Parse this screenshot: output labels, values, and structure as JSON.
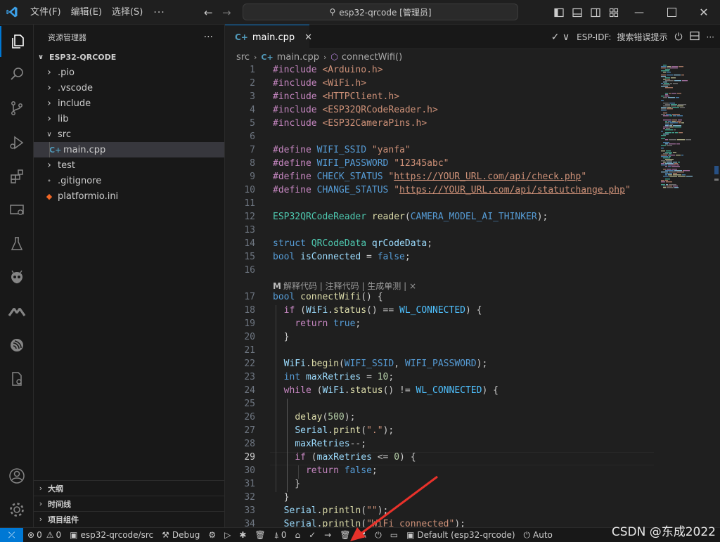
{
  "titlebar": {
    "menus": [
      "文件(F)",
      "编辑(E)",
      "选择(S)"
    ],
    "more": "···",
    "command_center": "esp32-qrcode [管理员]"
  },
  "sidebar": {
    "title": "资源管理器",
    "more": "···",
    "root": "ESP32-QRCODE",
    "items": [
      {
        "label": ".pio",
        "kind": "folder",
        "expanded": false
      },
      {
        "label": ".vscode",
        "kind": "folder",
        "expanded": false
      },
      {
        "label": "include",
        "kind": "folder",
        "expanded": false
      },
      {
        "label": "lib",
        "kind": "folder",
        "expanded": false
      },
      {
        "label": "src",
        "kind": "folder",
        "expanded": true
      },
      {
        "label": "main.cpp",
        "kind": "cpp",
        "selected": true
      },
      {
        "label": "test",
        "kind": "folder",
        "expanded": false
      },
      {
        "label": ".gitignore",
        "kind": "git"
      },
      {
        "label": "platformio.ini",
        "kind": "pio"
      }
    ],
    "sections": [
      "大纲",
      "时间线",
      "项目组件"
    ]
  },
  "editor": {
    "tab": "main.cpp",
    "tab_actions": {
      "idf": "ESP-IDF:",
      "search": "搜索错误提示"
    },
    "breadcrumb": [
      "src",
      "main.cpp",
      "connectWifi()"
    ],
    "codelens": "解释代码 | 注释代码 | 生成单测 | ×",
    "current_line": 29,
    "lines": [
      {
        "n": 1,
        "t": [
          [
            "pp",
            "#include"
          ],
          [
            "pn",
            " "
          ],
          [
            "st",
            "<Arduino.h>"
          ]
        ]
      },
      {
        "n": 2,
        "t": [
          [
            "pp",
            "#include"
          ],
          [
            "pn",
            " "
          ],
          [
            "st",
            "<WiFi.h>"
          ]
        ]
      },
      {
        "n": 3,
        "t": [
          [
            "pp",
            "#include"
          ],
          [
            "pn",
            " "
          ],
          [
            "st",
            "<HTTPClient.h>"
          ]
        ]
      },
      {
        "n": 4,
        "t": [
          [
            "pp",
            "#include"
          ],
          [
            "pn",
            " "
          ],
          [
            "st",
            "<ESP32QRCodeReader.h>"
          ]
        ]
      },
      {
        "n": 5,
        "t": [
          [
            "pp",
            "#include"
          ],
          [
            "pn",
            " "
          ],
          [
            "st",
            "<ESP32CameraPins.h>"
          ]
        ]
      },
      {
        "n": 6,
        "t": []
      },
      {
        "n": 7,
        "t": [
          [
            "pp",
            "#define"
          ],
          [
            "pn",
            " "
          ],
          [
            "ty",
            "WIFI_SSID"
          ],
          [
            "pn",
            " "
          ],
          [
            "st",
            "\"yanfa\""
          ]
        ]
      },
      {
        "n": 8,
        "t": [
          [
            "pp",
            "#define"
          ],
          [
            "pn",
            " "
          ],
          [
            "ty",
            "WIFI_PASSWORD"
          ],
          [
            "pn",
            " "
          ],
          [
            "st",
            "\"12345abc\""
          ]
        ]
      },
      {
        "n": 9,
        "t": [
          [
            "pp",
            "#define"
          ],
          [
            "pn",
            " "
          ],
          [
            "ty",
            "CHECK_STATUS"
          ],
          [
            "pn",
            " "
          ],
          [
            "st",
            "\""
          ],
          [
            "stu",
            "https://YOUR_URL.com/api/check.php"
          ],
          [
            "st",
            "\""
          ]
        ]
      },
      {
        "n": 10,
        "t": [
          [
            "pp",
            "#define"
          ],
          [
            "pn",
            " "
          ],
          [
            "ty",
            "CHANGE_STATUS"
          ],
          [
            "pn",
            " "
          ],
          [
            "st",
            "\""
          ],
          [
            "stu",
            "https://YOUR_URL.com/api/statutchange.php"
          ],
          [
            "st",
            "\""
          ]
        ]
      },
      {
        "n": 11,
        "t": []
      },
      {
        "n": 12,
        "t": [
          [
            "cl",
            "ESP32QRCodeReader"
          ],
          [
            "pn",
            " "
          ],
          [
            "fn",
            "reader"
          ],
          [
            "pn",
            "("
          ],
          [
            "ty",
            "CAMERA_MODEL_AI_THINKER"
          ],
          [
            "pn",
            ");"
          ]
        ]
      },
      {
        "n": 13,
        "t": []
      },
      {
        "n": 14,
        "t": [
          [
            "ty",
            "struct"
          ],
          [
            "pn",
            " "
          ],
          [
            "cl",
            "QRCodeData"
          ],
          [
            "pn",
            " "
          ],
          [
            "va",
            "qrCodeData"
          ],
          [
            "pn",
            ";"
          ]
        ]
      },
      {
        "n": 15,
        "t": [
          [
            "ty",
            "bool"
          ],
          [
            "pn",
            " "
          ],
          [
            "va",
            "isConnected"
          ],
          [
            "pn",
            " = "
          ],
          [
            "ty",
            "false"
          ],
          [
            "pn",
            ";"
          ]
        ]
      },
      {
        "n": 16,
        "t": []
      },
      {
        "n": 17,
        "t": [
          [
            "ty",
            "bool"
          ],
          [
            "pn",
            " "
          ],
          [
            "fn",
            "connectWifi"
          ],
          [
            "pn",
            "() {"
          ]
        ]
      },
      {
        "n": 18,
        "t": [
          [
            "pn",
            "  "
          ],
          [
            "kw",
            "if"
          ],
          [
            "pn",
            " ("
          ],
          [
            "va",
            "WiFi"
          ],
          [
            "pn",
            "."
          ],
          [
            "fn",
            "status"
          ],
          [
            "pn",
            "() == "
          ],
          [
            "co",
            "WL_CONNECTED"
          ],
          [
            "pn",
            ") {"
          ]
        ]
      },
      {
        "n": 19,
        "t": [
          [
            "pn",
            "    "
          ],
          [
            "kw",
            "return"
          ],
          [
            "pn",
            " "
          ],
          [
            "ty",
            "true"
          ],
          [
            "pn",
            ";"
          ]
        ]
      },
      {
        "n": 20,
        "t": [
          [
            "pn",
            "  }"
          ]
        ]
      },
      {
        "n": 21,
        "t": []
      },
      {
        "n": 22,
        "t": [
          [
            "pn",
            "  "
          ],
          [
            "va",
            "WiFi"
          ],
          [
            "pn",
            "."
          ],
          [
            "fn",
            "begin"
          ],
          [
            "pn",
            "("
          ],
          [
            "ty",
            "WIFI_SSID"
          ],
          [
            "pn",
            ", "
          ],
          [
            "ty",
            "WIFI_PASSWORD"
          ],
          [
            "pn",
            ");"
          ]
        ]
      },
      {
        "n": 23,
        "t": [
          [
            "pn",
            "  "
          ],
          [
            "ty",
            "int"
          ],
          [
            "pn",
            " "
          ],
          [
            "va",
            "maxRetries"
          ],
          [
            "pn",
            " = "
          ],
          [
            "nu",
            "10"
          ],
          [
            "pn",
            ";"
          ]
        ]
      },
      {
        "n": 24,
        "t": [
          [
            "pn",
            "  "
          ],
          [
            "kw",
            "while"
          ],
          [
            "pn",
            " ("
          ],
          [
            "va",
            "WiFi"
          ],
          [
            "pn",
            "."
          ],
          [
            "fn",
            "status"
          ],
          [
            "pn",
            "() != "
          ],
          [
            "co",
            "WL_CONNECTED"
          ],
          [
            "pn",
            ") {"
          ]
        ]
      },
      {
        "n": 25,
        "t": []
      },
      {
        "n": 26,
        "t": [
          [
            "pn",
            "    "
          ],
          [
            "fn",
            "delay"
          ],
          [
            "pn",
            "("
          ],
          [
            "nu",
            "500"
          ],
          [
            "pn",
            ");"
          ]
        ]
      },
      {
        "n": 27,
        "t": [
          [
            "pn",
            "    "
          ],
          [
            "va",
            "Serial"
          ],
          [
            "pn",
            "."
          ],
          [
            "fn",
            "print"
          ],
          [
            "pn",
            "("
          ],
          [
            "st",
            "\".\""
          ],
          [
            "pn",
            ");"
          ]
        ]
      },
      {
        "n": 28,
        "t": [
          [
            "pn",
            "    "
          ],
          [
            "va",
            "maxRetries"
          ],
          [
            "pn",
            "--;"
          ]
        ]
      },
      {
        "n": 29,
        "t": [
          [
            "pn",
            "    "
          ],
          [
            "kw",
            "if"
          ],
          [
            "pn",
            " ("
          ],
          [
            "va",
            "maxRetries"
          ],
          [
            "pn",
            " <= "
          ],
          [
            "nu",
            "0"
          ],
          [
            "pn",
            ") {"
          ]
        ]
      },
      {
        "n": 30,
        "t": [
          [
            "pn",
            "      "
          ],
          [
            "kw",
            "return"
          ],
          [
            "pn",
            " "
          ],
          [
            "ty",
            "false"
          ],
          [
            "pn",
            ";"
          ]
        ]
      },
      {
        "n": 31,
        "t": [
          [
            "pn",
            "    }"
          ]
        ]
      },
      {
        "n": 32,
        "t": [
          [
            "pn",
            "  }"
          ]
        ]
      },
      {
        "n": 33,
        "t": [
          [
            "pn",
            "  "
          ],
          [
            "va",
            "Serial"
          ],
          [
            "pn",
            "."
          ],
          [
            "fn",
            "println"
          ],
          [
            "pn",
            "("
          ],
          [
            "st",
            "\"\""
          ],
          [
            "pn",
            ");"
          ]
        ]
      },
      {
        "n": 34,
        "t": [
          [
            "pn",
            "  "
          ],
          [
            "va",
            "Serial"
          ],
          [
            "pn",
            "."
          ],
          [
            "fn",
            "println"
          ],
          [
            "pn",
            "("
          ],
          [
            "st",
            "\"WiFi connected\""
          ],
          [
            "pn",
            ");"
          ]
        ]
      }
    ]
  },
  "statusbar": {
    "errors": "0",
    "warnings": "0",
    "env": "esp32-qrcode/src",
    "debug": "Debug",
    "ports": "0",
    "project": "Default (esp32-qrcode)",
    "auto": "Auto"
  },
  "watermark": "CSDN @东成2022",
  "colors": {
    "accent": "#0078d4",
    "annotation_arrow": "#e8312a"
  }
}
